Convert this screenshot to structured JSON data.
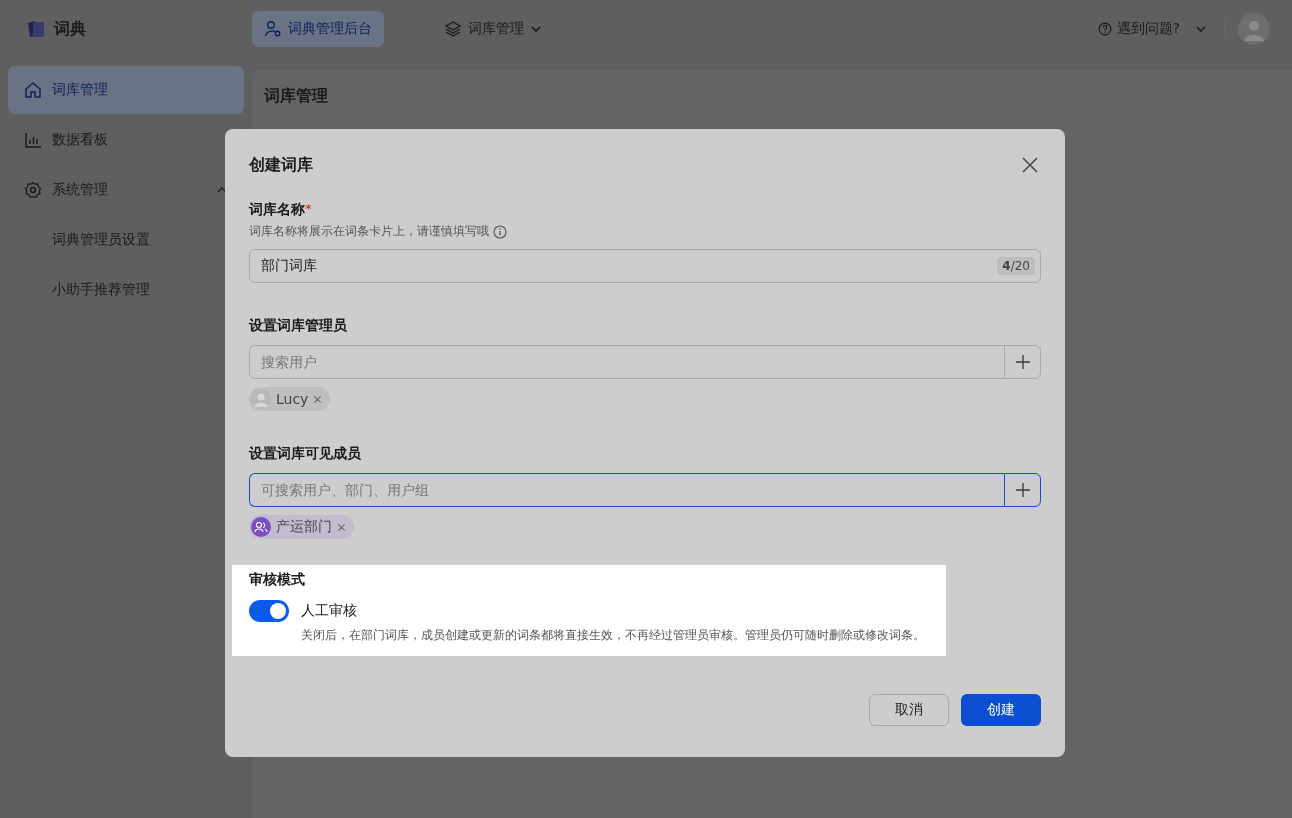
{
  "app": {
    "name": "词典"
  },
  "top_nav": [
    {
      "label": "词典管理后台",
      "selected": true,
      "dropdown": false
    },
    {
      "label": "词库管理",
      "selected": false,
      "dropdown": true
    }
  ],
  "help": {
    "label": "遇到问题?"
  },
  "sidebar": {
    "items": [
      {
        "label": "词库管理",
        "kind": "home",
        "selected": true
      },
      {
        "label": "数据看板",
        "kind": "chart",
        "selected": false
      },
      {
        "label": "系统管理",
        "kind": "gear",
        "selected": false,
        "expanded": true,
        "children": [
          {
            "label": "词典管理员设置",
            "selected": false
          },
          {
            "label": "小助手推荐管理",
            "selected": false
          }
        ]
      }
    ]
  },
  "page": {
    "title": "词库管理"
  },
  "dialog": {
    "title": "创建词库",
    "name_field": {
      "label": "词库名称",
      "required_mark": "*",
      "hint": "词库名称将展示在词条卡片上，请谨慎填写哦",
      "value": "部门词库",
      "count": "**4**/20"
    },
    "pickers": [
      {
        "label": "设置词库管理员",
        "placeholder": "搜索用户",
        "focused": false,
        "tags": [
          {
            "label": "Lucy",
            "kind": "user"
          }
        ]
      },
      {
        "label": "设置词库可见成员",
        "placeholder": "可搜索用户、部门、用户组",
        "focused": true,
        "tags": [
          {
            "label": "产运部门",
            "kind": "group"
          }
        ]
      }
    ],
    "review": {
      "label": "审核模式",
      "highlighted": true,
      "toggle": {
        "label": "人工审核",
        "on": true
      },
      "description": "关闭后，在部门词库，成员创建或更新的词条都将直接生效，不再经过管理员审核。管理员仍可随时删除或修改词条。"
    },
    "buttons": [
      {
        "label": "取消",
        "kind": "secondary"
      },
      {
        "label": "创建",
        "kind": "primary"
      }
    ]
  }
}
